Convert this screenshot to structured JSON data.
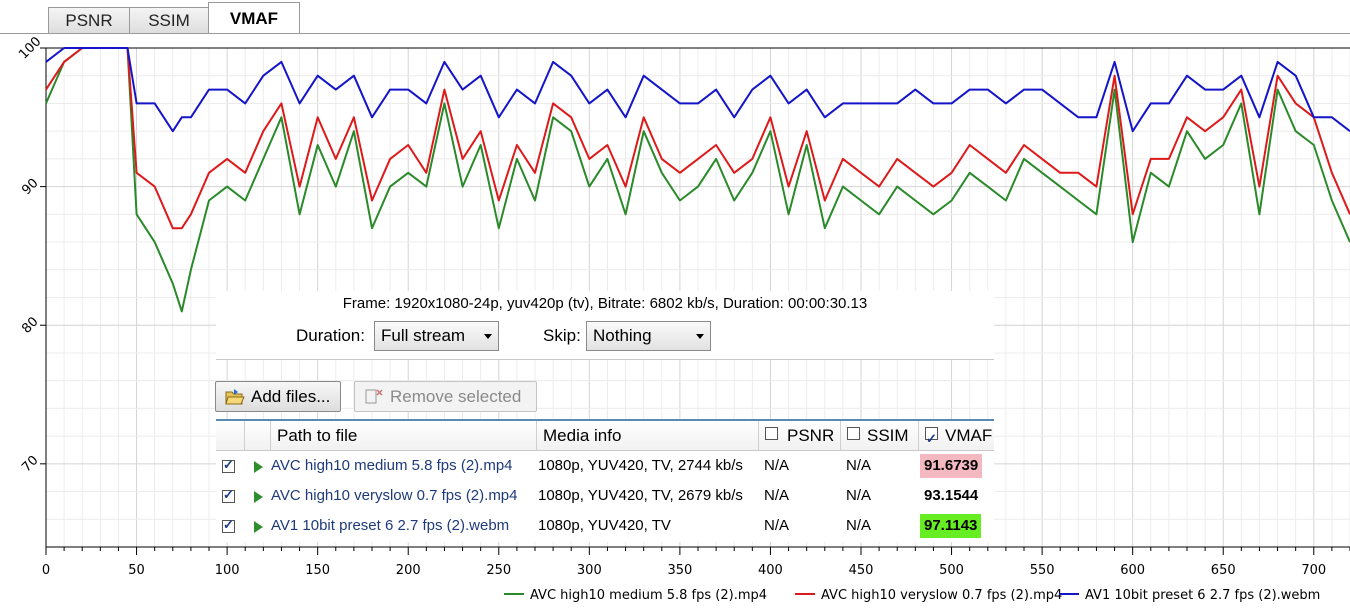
{
  "tabs": [
    {
      "label": "PSNR",
      "active": false
    },
    {
      "label": "SSIM",
      "active": false
    },
    {
      "label": "VMAF",
      "active": true
    }
  ],
  "chart_data": {
    "type": "line",
    "title": "",
    "xlabel": "",
    "ylabel": "",
    "xlim": [
      0,
      720
    ],
    "ylim": [
      64,
      100
    ],
    "x_ticks": [
      0,
      50,
      100,
      150,
      200,
      250,
      300,
      350,
      400,
      450,
      500,
      550,
      600,
      650,
      700
    ],
    "y_ticks": [
      100,
      90,
      80,
      70
    ],
    "grid": true,
    "legend_position": "bottom-right",
    "x": [
      0,
      10,
      20,
      30,
      40,
      45,
      50,
      60,
      70,
      75,
      80,
      90,
      100,
      110,
      120,
      130,
      140,
      150,
      160,
      170,
      180,
      190,
      200,
      210,
      220,
      230,
      240,
      250,
      260,
      270,
      280,
      290,
      300,
      310,
      320,
      330,
      340,
      350,
      360,
      370,
      380,
      390,
      400,
      410,
      420,
      430,
      440,
      450,
      460,
      470,
      480,
      490,
      500,
      510,
      520,
      530,
      540,
      550,
      560,
      570,
      580,
      590,
      600,
      610,
      620,
      630,
      640,
      650,
      660,
      670,
      680,
      690,
      700,
      710,
      720
    ],
    "series": [
      {
        "name": "AVC high10 medium 5.8 fps (2).mp4",
        "color": "#2a8a2a",
        "values": [
          96,
          99,
          100,
          100,
          100,
          100,
          88,
          86,
          83,
          81,
          84,
          89,
          90,
          89,
          92,
          95,
          88,
          93,
          90,
          94,
          87,
          90,
          91,
          90,
          96,
          90,
          93,
          87,
          92,
          89,
          95,
          94,
          90,
          92,
          88,
          94,
          91,
          89,
          90,
          92,
          89,
          91,
          94,
          88,
          93,
          87,
          90,
          89,
          88,
          90,
          89,
          88,
          89,
          91,
          90,
          89,
          92,
          91,
          90,
          89,
          88,
          97,
          86,
          91,
          90,
          94,
          92,
          93,
          96,
          88,
          97,
          94,
          93,
          89,
          86
        ]
      },
      {
        "name": "AVC high10 veryslow 0.7 fps (2).mp4",
        "color": "#dd1a1a",
        "values": [
          97,
          99,
          100,
          100,
          100,
          100,
          91,
          90,
          87,
          87,
          88,
          91,
          92,
          91,
          94,
          96,
          90,
          95,
          92,
          95,
          89,
          92,
          93,
          91,
          97,
          92,
          94,
          89,
          93,
          91,
          96,
          95,
          92,
          93,
          90,
          95,
          92,
          91,
          92,
          93,
          91,
          92,
          95,
          90,
          94,
          89,
          92,
          91,
          90,
          92,
          91,
          90,
          91,
          93,
          92,
          91,
          93,
          92,
          91,
          91,
          90,
          98,
          88,
          92,
          92,
          95,
          94,
          95,
          97,
          90,
          98,
          96,
          95,
          91,
          88
        ]
      },
      {
        "name": "AV1 10bit preset 6 2.7 fps (2).webm",
        "color": "#1414c8",
        "values": [
          99,
          100,
          100,
          100,
          100,
          100,
          96,
          96,
          94,
          95,
          95,
          97,
          97,
          96,
          98,
          99,
          96,
          98,
          97,
          98,
          95,
          97,
          97,
          96,
          99,
          97,
          98,
          95,
          97,
          96,
          99,
          98,
          96,
          97,
          95,
          98,
          97,
          96,
          96,
          97,
          95,
          97,
          98,
          96,
          97,
          95,
          96,
          96,
          96,
          96,
          97,
          96,
          96,
          97,
          97,
          96,
          97,
          97,
          96,
          95,
          95,
          99,
          94,
          96,
          96,
          98,
          97,
          97,
          98,
          95,
          99,
          98,
          95,
          95,
          94
        ]
      }
    ]
  },
  "info": {
    "frame_text": "Frame: 1920x1080-24p, yuv420p (tv), Bitrate: 6802 kb/s, Duration: 00:00:30.13",
    "duration_label": "Duration:",
    "duration_value": "Full stream",
    "skip_label": "Skip:",
    "skip_value": "Nothing"
  },
  "toolbar": {
    "add_files": "Add files...",
    "remove_selected": "Remove selected"
  },
  "table": {
    "headers": {
      "path": "Path to file",
      "media": "Media info",
      "psnr": "PSNR",
      "ssim": "SSIM",
      "vmaf": "VMAF"
    },
    "header_checks": {
      "psnr": false,
      "ssim": false,
      "vmaf": true
    },
    "rows": [
      {
        "checked": true,
        "path": "AVC high10 medium 5.8 fps (2).mp4",
        "media": "1080p, YUV420, TV, 2744 kb/s",
        "psnr": "N/A",
        "ssim": "N/A",
        "vmaf": "91.6739",
        "vmaf_bg": "#f4b8c0"
      },
      {
        "checked": true,
        "path": "AVC high10 veryslow 0.7 fps (2).mp4",
        "media": "1080p, YUV420, TV, 2679 kb/s",
        "psnr": "N/A",
        "ssim": "N/A",
        "vmaf": "93.1544",
        "vmaf_bg": "#ffffff"
      },
      {
        "checked": true,
        "path": "AV1 10bit preset 6 2.7 fps (2).webm",
        "media": "1080p, YUV420, TV",
        "psnr": "N/A",
        "ssim": "N/A",
        "vmaf": "97.1143",
        "vmaf_bg": "#66ee22"
      }
    ]
  }
}
